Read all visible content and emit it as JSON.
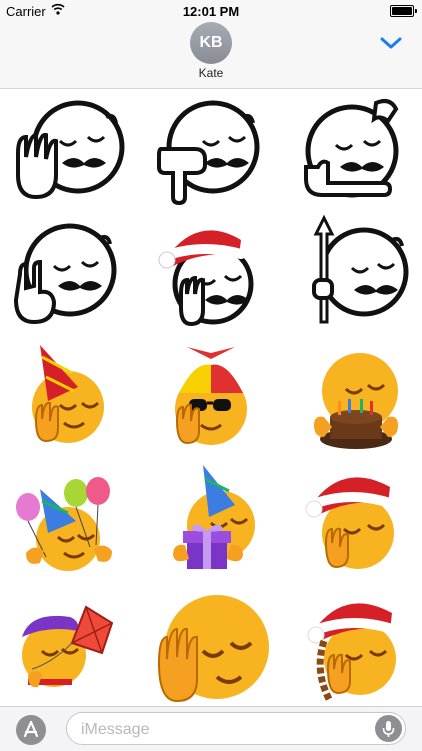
{
  "status_bar": {
    "carrier": "Carrier",
    "time": "12:01 PM"
  },
  "header": {
    "avatar_initials": "KB",
    "contact_name": "Kate"
  },
  "stickers": [
    {
      "name": "facepalm-mustache-outline"
    },
    {
      "name": "pointing-down-mustache-outline"
    },
    {
      "name": "hand-on-head-mustache-outline"
    },
    {
      "name": "rock-hand-mustache-outline"
    },
    {
      "name": "santa-hat-mustache-outline"
    },
    {
      "name": "rocket-holding-mustache-outline"
    },
    {
      "name": "party-hat-facepalm-emoji"
    },
    {
      "name": "propeller-cap-sunglasses-emoji"
    },
    {
      "name": "birthday-cake-emoji"
    },
    {
      "name": "balloons-party-emoji"
    },
    {
      "name": "gift-box-emoji"
    },
    {
      "name": "santa-hat-emoji"
    },
    {
      "name": "kite-purple-cap-emoji"
    },
    {
      "name": "facepalm-emoji"
    },
    {
      "name": "santa-hat-braid-emoji"
    }
  ],
  "message_input": {
    "placeholder": "iMessage"
  },
  "colors": {
    "accent": "#1a7cf5",
    "emoji_yellow": "#f7b320",
    "santa_red": "#d52027"
  }
}
